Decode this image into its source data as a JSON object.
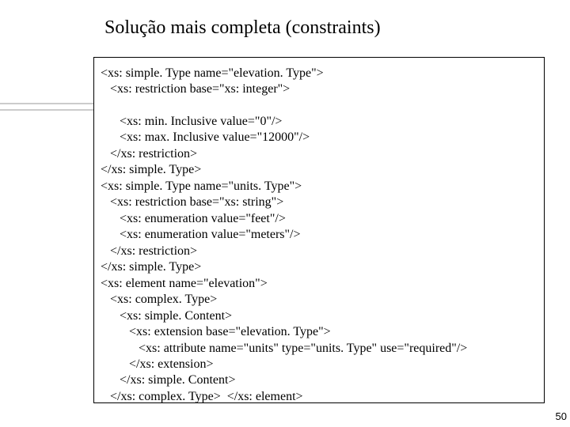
{
  "title": "Solução mais completa (constraints)",
  "page_number": "50",
  "code": [
    "<xs: simple. Type name=\"elevation. Type\">",
    "   <xs: restriction base=\"xs: integer\">",
    "",
    "      <xs: min. Inclusive value=\"0\"/>",
    "      <xs: max. Inclusive value=\"12000\"/>",
    "   </xs: restriction>",
    "</xs: simple. Type>",
    "<xs: simple. Type name=\"units. Type\">",
    "   <xs: restriction base=\"xs: string\">",
    "      <xs: enumeration value=\"feet\"/>",
    "      <xs: enumeration value=\"meters\"/>",
    "   </xs: restriction>",
    "</xs: simple. Type>",
    "<xs: element name=\"elevation\">",
    "   <xs: complex. Type>",
    "      <xs: simple. Content>",
    "         <xs: extension base=\"elevation. Type\">",
    "            <xs: attribute name=\"units\" type=\"units. Type\" use=\"required\"/>",
    "         </xs: extension>",
    "      </xs: simple. Content>",
    "   </xs: complex. Type>  </xs: element>"
  ]
}
